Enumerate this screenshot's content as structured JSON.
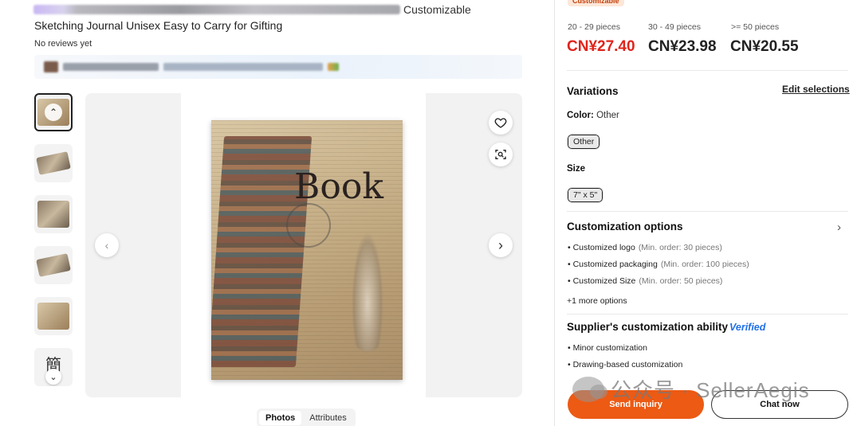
{
  "product": {
    "title_suffix": "Customizable",
    "title_line2": "Sketching Journal Unisex Easy to Carry for Gifting",
    "reviews": "No reviews yet"
  },
  "gallery": {
    "main_cover_word": "Book",
    "thumbnail_glyph": "簡",
    "icons": [
      "heart-icon",
      "visual-search-icon",
      "chevron-left-icon",
      "chevron-right-icon",
      "chevron-down-icon",
      "chevron-up-icon"
    ]
  },
  "tabs": [
    {
      "label": "Photos",
      "active": true
    },
    {
      "label": "Attributes",
      "active": false
    }
  ],
  "pricing": {
    "badge": "Customizable",
    "tiers": [
      {
        "range": "20 - 29 pieces",
        "price": "CN¥27.40",
        "highlight": true
      },
      {
        "range": "30 - 49 pieces",
        "price": "CN¥23.98",
        "highlight": false
      },
      {
        "range": ">= 50 pieces",
        "price": "CN¥20.55",
        "highlight": false
      }
    ]
  },
  "variations": {
    "title": "Variations",
    "edit_label": "Edit selections",
    "color_label": "Color:",
    "color_value": "Other",
    "color_option": "Other",
    "size_label": "Size",
    "size_option": "7\" x 5\""
  },
  "customization": {
    "title": "Customization options",
    "items": [
      {
        "name": "Customized logo",
        "note": "(Min. order: 30 pieces)"
      },
      {
        "name": "Customized packaging",
        "note": "(Min. order: 100 pieces)"
      },
      {
        "name": "Customized Size",
        "note": "(Min. order: 50 pieces)"
      }
    ],
    "more": "+1 more options"
  },
  "ability": {
    "title": "Supplier's customization ability",
    "verified": "Verified",
    "items": [
      "Minor customization",
      "Drawing-based customization"
    ]
  },
  "actions": {
    "inquiry": "Send inquiry",
    "chat": "Chat now"
  },
  "watermark": {
    "text": "公众号 · SellerAegis"
  },
  "colors": {
    "accent": "#ec5a14",
    "price_red": "#e0241b",
    "verified_blue": "#1f6fe6"
  }
}
